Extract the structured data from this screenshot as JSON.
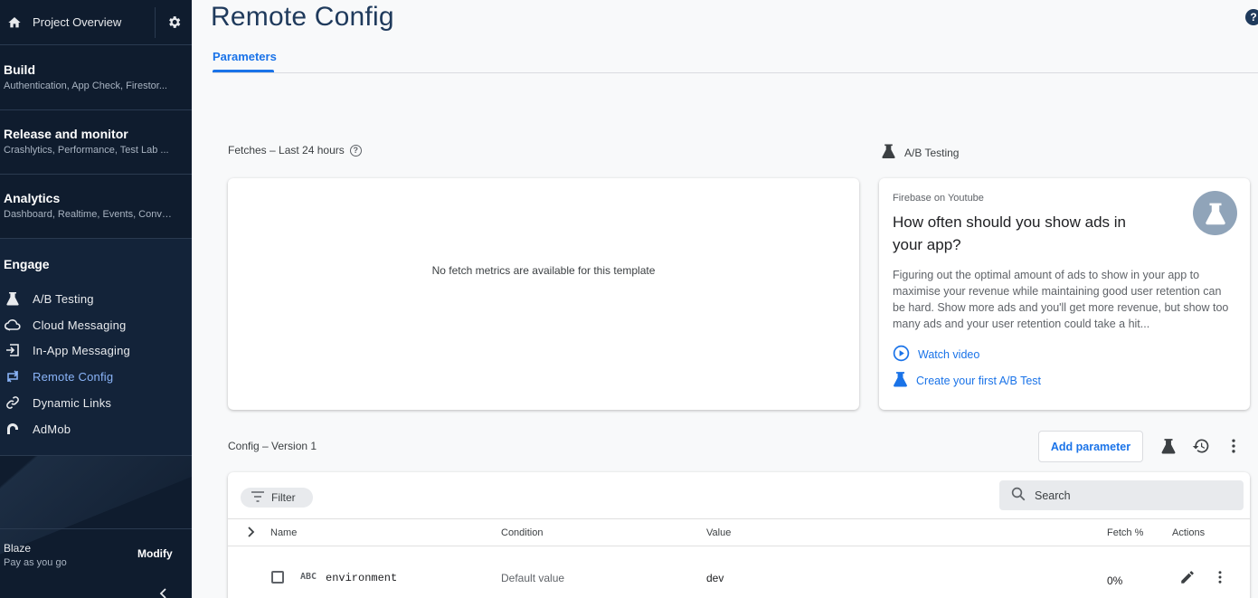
{
  "sidebar": {
    "project_overview": "Project Overview",
    "sections": [
      {
        "title": "Build",
        "subtitle": "Authentication, App Check, Firestor..."
      },
      {
        "title": "Release and monitor",
        "subtitle": "Crashlytics, Performance, Test Lab ..."
      },
      {
        "title": "Analytics",
        "subtitle": "Dashboard, Realtime, Events, Conve..."
      }
    ],
    "engage": {
      "title": "Engage",
      "items": [
        {
          "label": "A/B Testing",
          "icon": "flask-icon"
        },
        {
          "label": "Cloud Messaging",
          "icon": "cloud-messaging-icon"
        },
        {
          "label": "In-App Messaging",
          "icon": "in-app-messaging-icon"
        },
        {
          "label": "Remote Config",
          "icon": "remote-config-icon",
          "active": true
        },
        {
          "label": "Dynamic Links",
          "icon": "link-icon"
        },
        {
          "label": "AdMob",
          "icon": "admob-icon"
        }
      ]
    },
    "plan": {
      "name": "Blaze",
      "desc": "Pay as you go",
      "action": "Modify"
    }
  },
  "header": {
    "title": "Remote Config",
    "help": "?"
  },
  "tabs": [
    {
      "label": "Parameters",
      "active": true
    }
  ],
  "fetches": {
    "label": "Fetches – Last 24 hours",
    "empty_text": "No fetch metrics are available for this template"
  },
  "ab_testing": {
    "label": "A/B Testing",
    "kicker": "Firebase on Youtube",
    "headline": "How often should you show ads in your app?",
    "body": "Figuring out the optimal amount of ads to show in your app to maximise your revenue while maintaining good user retention can be hard. Show more ads and you'll get more revenue, but show too many ads and your user retention could take a hit...",
    "watch_video": "Watch video",
    "create_test": "Create your first A/B Test"
  },
  "config": {
    "label": "Config – Version 1",
    "add_parameter": "Add parameter",
    "filter": "Filter",
    "search_placeholder": "Search",
    "columns": {
      "name": "Name",
      "condition": "Condition",
      "value": "Value",
      "fetch": "Fetch %",
      "actions": "Actions"
    },
    "rows": [
      {
        "type": "ABC",
        "name": "environment",
        "condition": "Default value",
        "value": "dev",
        "fetch": "0%"
      }
    ]
  },
  "colors": {
    "sidebar_bg": "#0f1c2e",
    "accent": "#1a73e8",
    "active_nav": "#8ab4f8",
    "title": "#1f3a5c"
  }
}
